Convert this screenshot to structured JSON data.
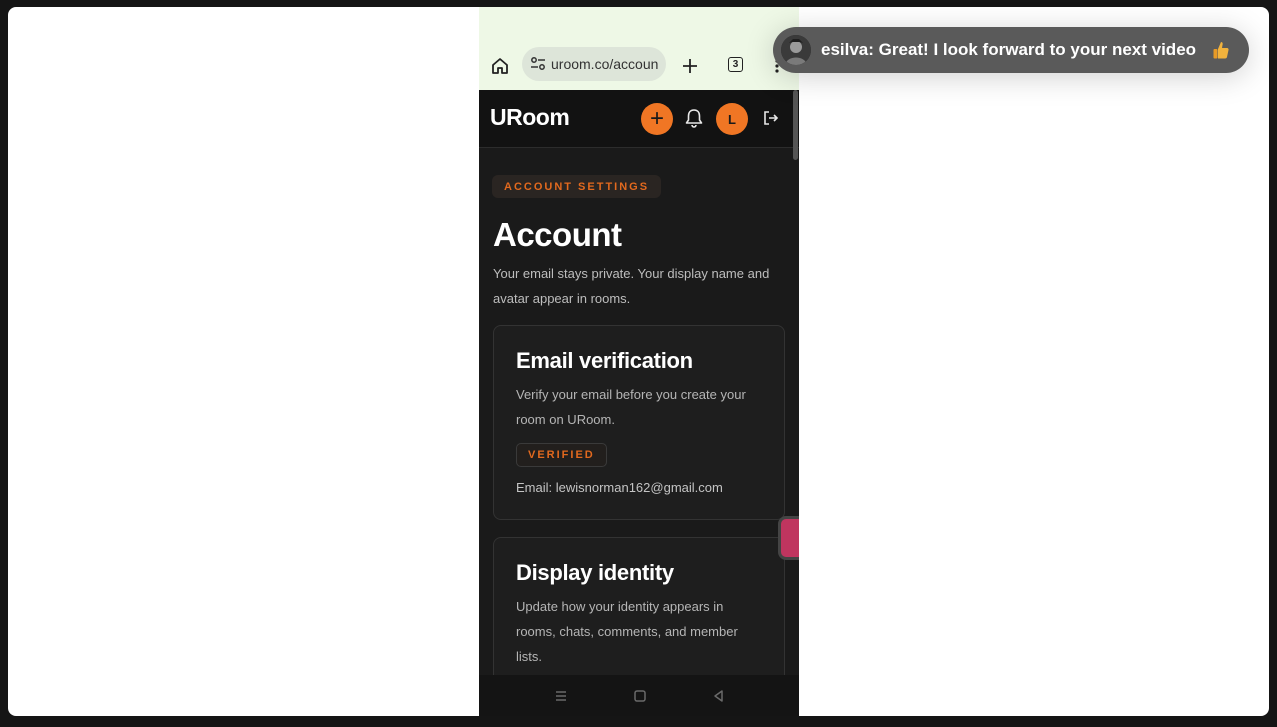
{
  "browser": {
    "url": "uroom.co/accoun",
    "tab_count": "3"
  },
  "app": {
    "logo": "URoom",
    "avatar_initial": "L"
  },
  "page": {
    "chip": "ACCOUNT SETTINGS",
    "title": "Account",
    "lead": "Your email stays private. Your display name and avatar appear in rooms."
  },
  "email_card": {
    "title": "Email verification",
    "text": "Verify your email before you create your room on URoom.",
    "badge": "VERIFIED",
    "email": "Email: lewisnorman162@gmail.com"
  },
  "identity_card": {
    "title": "Display identity",
    "text": "Update how your identity appears in rooms, chats, comments, and member lists."
  },
  "toast": {
    "message": "esilva: Great! I look forward to your next video",
    "emoji": "thumbs-up-icon"
  },
  "colors": {
    "accent": "#f07624",
    "chip_text": "#e2691e",
    "background": "#1a1a1a"
  }
}
